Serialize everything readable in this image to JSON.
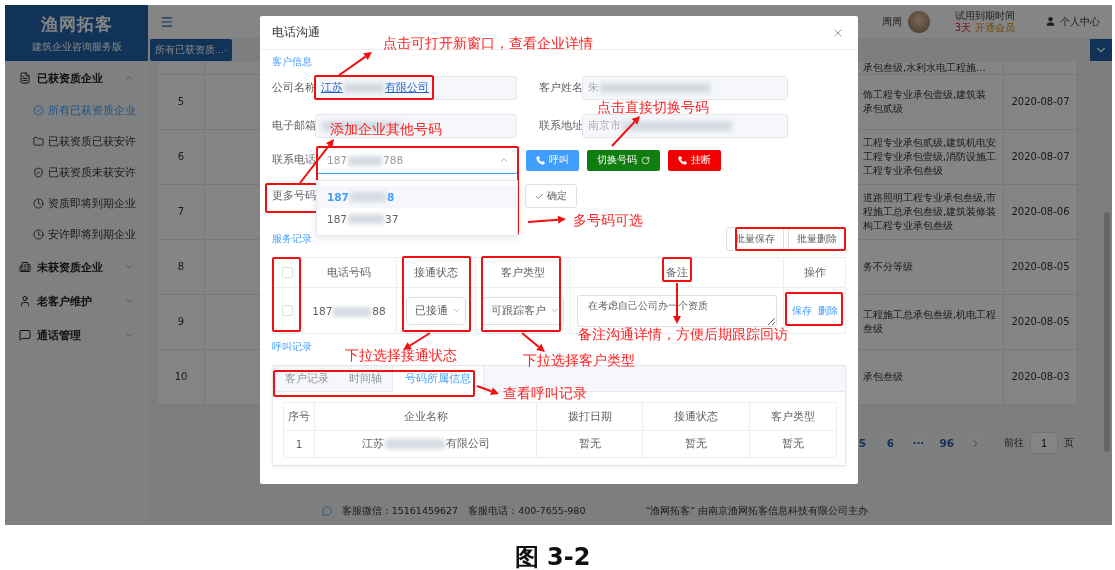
{
  "sidebar": {
    "logo": "渔网拓客",
    "subtitle": "建筑企业咨询服务版",
    "groups": [
      {
        "label": "已获资质企业",
        "expanded": true,
        "children": [
          {
            "label": "所有已获资质企业",
            "selected": true
          },
          {
            "label": "已获资质已获安许",
            "selected": false
          },
          {
            "label": "已获资质未获安许",
            "selected": false
          },
          {
            "label": "资质即将到期企业",
            "selected": false
          },
          {
            "label": "安许即将到期企业",
            "selected": false
          }
        ]
      },
      {
        "label": "未获资质企业",
        "expanded": false
      },
      {
        "label": "老客户维护",
        "expanded": false
      },
      {
        "label": "通话管理",
        "expanded": false
      }
    ]
  },
  "header": {
    "user": "周周",
    "trial_label": "试用到期时间",
    "trial_days": "3天",
    "upgrade": "开通会员",
    "profile": "个人中心"
  },
  "tabs": [
    {
      "label": "所有已获资质...",
      "selected": true
    }
  ],
  "table": {
    "rows": [
      {
        "detail": [
          "承包叁级,水利水电工程施..."
        ]
      },
      {
        "index": "5",
        "detail": [
          "饰工程专业承包壹级,建筑装",
          "承包贰级"
        ],
        "date": "2020-08-07"
      },
      {
        "index": "6",
        "detail": [
          "工程专业承包贰级,建筑机电安",
          "工程专业承包壹级,消防设施工",
          "工程专业承包叁级"
        ],
        "date": "2020-08-07"
      },
      {
        "index": "7",
        "detail": [
          "道路照明工程专业承包叁级,市",
          "程施工总承包叁级,建筑装修装",
          "构工程专业承包叁级"
        ],
        "date": "2020-08-06"
      },
      {
        "index": "8",
        "detail": [
          "务不分等级"
        ],
        "date": "2020-08-05"
      },
      {
        "index": "9",
        "detail": [
          "工程施工总承包叁级,机电工程",
          "叁级"
        ],
        "date": "2020-08-05"
      },
      {
        "index": "10",
        "detail": [
          "承包叁级"
        ],
        "date": "2020-08-03"
      }
    ]
  },
  "pagination": {
    "pages": [
      "5",
      "6",
      "···",
      "96"
    ],
    "goto_label": "前往",
    "goto_value": "1",
    "page_unit": "页"
  },
  "footer": {
    "wechat": "客服微信：15161459627",
    "phone": "客服电话：400-7655-980",
    "host": "“渔网拓客” 由南京渔网拓客信息科技有限公司主办"
  },
  "dialog": {
    "title": "电话沟通",
    "customer_section": "客户信息",
    "fields": [
      {
        "label": "公司名称",
        "kind": "link",
        "parts": [
          "江苏",
          "有限公司"
        ]
      },
      {
        "label": "客户姓名",
        "kind": "text",
        "parts": [
          "朱"
        ]
      },
      {
        "label": "电子邮箱",
        "kind": "text"
      },
      {
        "label": "联系地址",
        "kind": "text",
        "parts": [
          "南京市"
        ]
      }
    ],
    "phone": {
      "label": "联系电话",
      "parts": [
        "187",
        "788"
      ],
      "expanded": true,
      "options": [
        {
          "parts": [
            "187",
            "8"
          ],
          "selected": true
        },
        {
          "parts": [
            "187",
            "37"
          ],
          "selected": false
        }
      ]
    },
    "call_buttons": [
      {
        "label": "呼叫",
        "kind": "call"
      },
      {
        "label": "切换号码",
        "kind": "switch"
      },
      {
        "label": "挂断",
        "kind": "hangup"
      }
    ],
    "more_numbers": {
      "label": "更多号码",
      "confirm": "确定"
    },
    "service_section": "服务记录",
    "batch_buttons": [
      "批量保存",
      "批量删除"
    ],
    "service_table": {
      "header_checked": false,
      "columns": [
        "电话号码",
        "接通状态",
        "客户类型",
        "备注",
        "操作"
      ],
      "rows": [
        {
          "checked": false,
          "phone_parts": [
            "187",
            "88"
          ],
          "status": "已接通",
          "customer_type": "可跟踪客户",
          "note": "在考虑自己公司办一个资质",
          "actions": [
            "保存",
            "删除"
          ]
        }
      ]
    },
    "call_section": "呼叫记录",
    "call_tabs": [
      {
        "label": "客户记录",
        "selected": false
      },
      {
        "label": "时间轴",
        "selected": false
      },
      {
        "label": "号码所属信息",
        "selected": true
      }
    ],
    "call_table": {
      "columns": [
        "序号",
        "企业名称",
        "拨打日期",
        "接通状态",
        "客户类型"
      ],
      "rows": [
        {
          "index": "1",
          "company_parts": [
            "江苏",
            "有限公司"
          ],
          "date": "暂无",
          "status": "暂无",
          "customer_type": "暂无"
        }
      ]
    }
  },
  "annotations": [
    "点击可打开新窗口，查看企业详情",
    "点击直接切换号码",
    "添加企业其他号码",
    "多号码可选",
    "备注沟通详情，方便后期跟踪回访",
    "下拉选择接通状态",
    "下拉选择客户类型",
    "查看呼叫记录"
  ],
  "caption": "图 3-2"
}
